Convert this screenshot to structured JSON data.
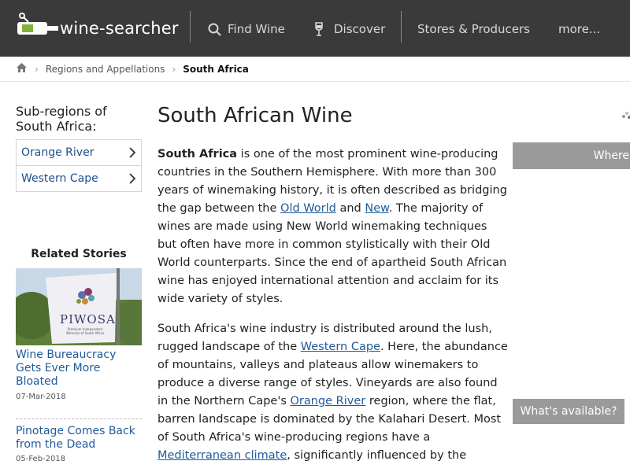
{
  "header": {
    "logo_text": "wine-searcher",
    "nav": [
      {
        "label": "Find Wine",
        "icon": "search-icon"
      },
      {
        "label": "Discover",
        "icon": "wine-glass-icon"
      },
      {
        "label": "Stores & Producers"
      },
      {
        "label": "more..."
      }
    ]
  },
  "breadcrumb": {
    "home_icon": "home-icon",
    "items": [
      "Regions and Appellations",
      "South Africa"
    ]
  },
  "sidebar": {
    "heading": "Sub-regions of South Africa:",
    "subregions": [
      "Orange River",
      "Western Cape"
    ],
    "related_title": "Related Stories",
    "stories": [
      {
        "title": "Wine Bureaucracy Gets Ever More Bloated",
        "date": "07-Mar-2018"
      },
      {
        "title": "Pinotage Comes Back from the Dead",
        "date": "05-Feb-2018"
      }
    ],
    "banner_text": "PIWOSA",
    "banner_subtext": "Premium Independent Wineries of South Africa"
  },
  "main": {
    "title": "South African Wine",
    "p1": {
      "lead": "South Africa",
      "t1": " is one of the most prominent wine-producing countries in the Southern Hemisphere. With more than 300 years of winemaking history, it is often described as bridging the gap between the ",
      "link1": "Old World",
      "t2": " and ",
      "link2": "New",
      "t3": ". The majority of wines are made using New World winemaking techniques but often have more in common stylistically with their Old World counterparts. Since the end of apartheid South African wine has enjoyed international attention and acclaim for its wide variety of styles."
    },
    "p2": {
      "t1": "South Africa's wine industry is distributed around the lush, rugged landscape of the ",
      "link1": "Western Cape",
      "t2": ". Here, the abundance of mountains, valleys and plateaus allow winemakers to produce a diverse range of styles. Vineyards are also found in the Northern Cape's ",
      "link2": "Orange River",
      "t3": " region, where the flat, barren landscape is dominated by the Kalahari Desert. Most of South Africa's wine-producing regions have a ",
      "link3": "Mediterranean climate",
      "t4": ", significantly influenced by the"
    }
  },
  "right": {
    "where_label": "Where",
    "available_label": "What's available?"
  },
  "colors": {
    "header_bg": "#3a3a3a",
    "link": "#1f5a9a",
    "button_gray": "#9a9a9a"
  }
}
